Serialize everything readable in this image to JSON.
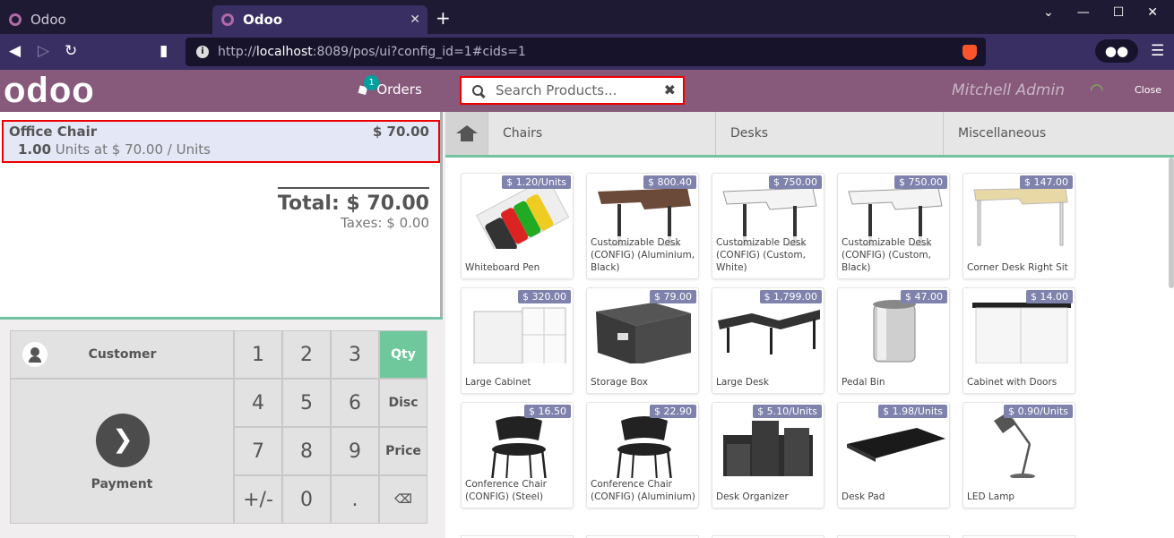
{
  "browser": {
    "tabs": [
      {
        "title": "Odoo",
        "active": false
      },
      {
        "title": "Odoo",
        "active": true
      }
    ],
    "url_prefix": "http://",
    "url_host": "localhost",
    "url_rest": ":8089/pos/ui?config_id=1#cids=1"
  },
  "header": {
    "logo": "odoo",
    "orders_label": "Orders",
    "orders_badge": "1",
    "search_placeholder": "Search Products...",
    "user": "Mitchell Admin",
    "close_label": "Close"
  },
  "order": {
    "line": {
      "product": "Office Chair",
      "price": "$ 70.00",
      "qty": "1.00",
      "unit_info": "Units at $ 70.00 / Units"
    },
    "total": "Total: $ 70.00",
    "taxes": "Taxes: $ 0.00"
  },
  "controls": {
    "customer_label": "Customer",
    "payment_label": "Payment",
    "keys": [
      "1",
      "2",
      "3",
      "Qty",
      "4",
      "5",
      "6",
      "Disc",
      "7",
      "8",
      "9",
      "Price",
      "+/-",
      "0",
      ".",
      "⌫"
    ],
    "active_mode": "Qty",
    "active_color": "#6ec89b"
  },
  "categories": [
    "Chairs",
    "Desks",
    "Miscellaneous"
  ],
  "products": [
    {
      "name": "Whiteboard Pen",
      "price": "$ 1.20/Units",
      "icon": "pen"
    },
    {
      "name": "Customizable Desk (CONFIG) (Aluminium, Black)",
      "price": "$ 800.40",
      "icon": "desk-dark"
    },
    {
      "name": "Customizable Desk (CONFIG) (Custom, White)",
      "price": "$ 750.00",
      "icon": "desk-white"
    },
    {
      "name": "Customizable Desk (CONFIG) (Custom, Black)",
      "price": "$ 750.00",
      "icon": "desk-white"
    },
    {
      "name": "Corner Desk Right Sit",
      "price": "$ 147.00",
      "icon": "desk-wood"
    },
    {
      "name": "Large Cabinet",
      "price": "$ 320.00",
      "icon": "cabinet"
    },
    {
      "name": "Storage Box",
      "price": "$ 79.00",
      "icon": "box"
    },
    {
      "name": "Large Desk",
      "price": "$ 1,799.00",
      "icon": "large-desk"
    },
    {
      "name": "Pedal Bin",
      "price": "$ 47.00",
      "icon": "bin"
    },
    {
      "name": "Cabinet with Doors",
      "price": "$ 14.00",
      "icon": "cabinet-doors"
    },
    {
      "name": "Conference Chair (CONFIG) (Steel)",
      "price": "$ 16.50",
      "icon": "chair"
    },
    {
      "name": "Conference Chair (CONFIG) (Aluminium)",
      "price": "$ 22.90",
      "icon": "chair"
    },
    {
      "name": "Desk Organizer",
      "price": "$ 5.10/Units",
      "icon": "organizer"
    },
    {
      "name": "Desk Pad",
      "price": "$ 1.98/Units",
      "icon": "pad"
    },
    {
      "name": "LED Lamp",
      "price": "$ 0.90/Units",
      "icon": "lamp"
    }
  ]
}
